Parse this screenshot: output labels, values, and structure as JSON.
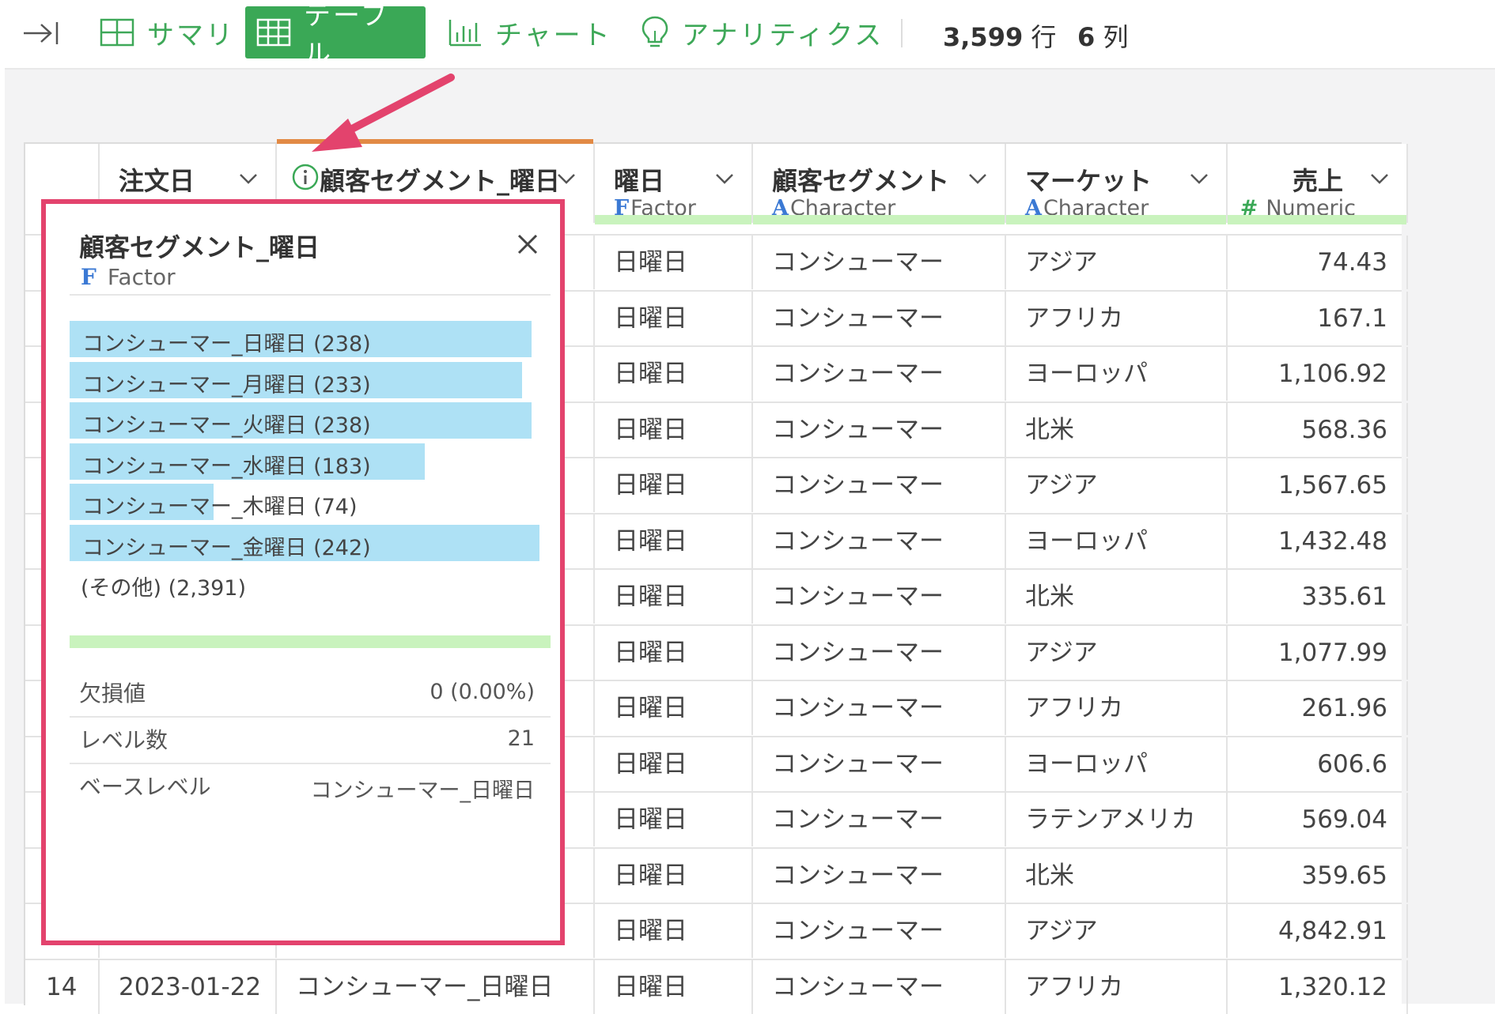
{
  "toolbar": {
    "tabs": [
      {
        "label": "サマリ",
        "icon": "grid-icon"
      },
      {
        "label": "テーブル",
        "icon": "table-icon",
        "active": true
      },
      {
        "label": "チャート",
        "icon": "bar-chart-icon"
      },
      {
        "label": "アナリティクス",
        "icon": "lightbulb-icon"
      }
    ],
    "rows_count": "3,599",
    "rows_unit": "行",
    "cols_count": "6",
    "cols_unit": "列"
  },
  "colors": {
    "accent_green": "#3aa856",
    "popup_border": "#e3436d",
    "bar_blue": "#aee1f5",
    "quality_bar": "#c9f3bd",
    "selected_column_top": "#e28a45"
  },
  "table": {
    "columns": [
      {
        "name": "注文日",
        "type_glyph": "",
        "type": ""
      },
      {
        "name": "顧客セグメント_曜日",
        "type_glyph": "",
        "type": ""
      },
      {
        "name": "曜日",
        "type_glyph": "F",
        "type": "Factor"
      },
      {
        "name": "顧客セグメント",
        "type_glyph": "A",
        "type": "Character"
      },
      {
        "name": "マーケット",
        "type_glyph": "A",
        "type": "Character"
      },
      {
        "name": "売上",
        "type_glyph": "#",
        "type": "Numeric"
      }
    ],
    "rows": [
      [
        "",
        "",
        "",
        "日曜日",
        "コンシューマー",
        "アジア",
        "74.43"
      ],
      [
        "",
        "",
        "",
        "日曜日",
        "コンシューマー",
        "アフリカ",
        "167.1"
      ],
      [
        "",
        "",
        "",
        "日曜日",
        "コンシューマー",
        "ヨーロッパ",
        "1,106.92"
      ],
      [
        "",
        "",
        "",
        "日曜日",
        "コンシューマー",
        "北米",
        "568.36"
      ],
      [
        "",
        "",
        "",
        "日曜日",
        "コンシューマー",
        "アジア",
        "1,567.65"
      ],
      [
        "",
        "",
        "",
        "日曜日",
        "コンシューマー",
        "ヨーロッパ",
        "1,432.48"
      ],
      [
        "",
        "",
        "",
        "日曜日",
        "コンシューマー",
        "北米",
        "335.61"
      ],
      [
        "",
        "",
        "",
        "日曜日",
        "コンシューマー",
        "アジア",
        "1,077.99"
      ],
      [
        "",
        "",
        "",
        "日曜日",
        "コンシューマー",
        "アフリカ",
        "261.96"
      ],
      [
        "",
        "",
        "",
        "日曜日",
        "コンシューマー",
        "ヨーロッパ",
        "606.6"
      ],
      [
        "",
        "",
        "",
        "日曜日",
        "コンシューマー",
        "ラテンアメリカ",
        "569.04"
      ],
      [
        "",
        "",
        "",
        "日曜日",
        "コンシューマー",
        "北米",
        "359.65"
      ],
      [
        "",
        "",
        "",
        "日曜日",
        "コンシューマー",
        "アジア",
        "4,842.91"
      ],
      [
        "14",
        "2023-01-22",
        "コンシューマー_日曜日",
        "日曜日",
        "コンシューマー",
        "アフリカ",
        "1,320.12"
      ]
    ]
  },
  "popup": {
    "title": "顧客セグメント_曜日",
    "type_glyph": "F",
    "type": "Factor",
    "levels": [
      {
        "label": "コンシューマー_日曜日 (238)",
        "fraction": 0.983
      },
      {
        "label": "コンシューマー_月曜日 (233)",
        "fraction": 0.963
      },
      {
        "label": "コンシューマー_火曜日 (238)",
        "fraction": 0.983
      },
      {
        "label": "コンシューマー_水曜日 (183)",
        "fraction": 0.756
      },
      {
        "label": "コンシューマー_木曜日 (74)",
        "fraction": 0.306
      },
      {
        "label": "コンシューマー_金曜日 (242)",
        "fraction": 1.0
      }
    ],
    "other": "(その他) (2,391)",
    "stats": [
      {
        "label": "欠損値",
        "value": "0 (0.00%)"
      },
      {
        "label": "レベル数",
        "value": "21"
      },
      {
        "label": "ベースレベル",
        "value": "コンシューマー_日曜日"
      }
    ]
  }
}
